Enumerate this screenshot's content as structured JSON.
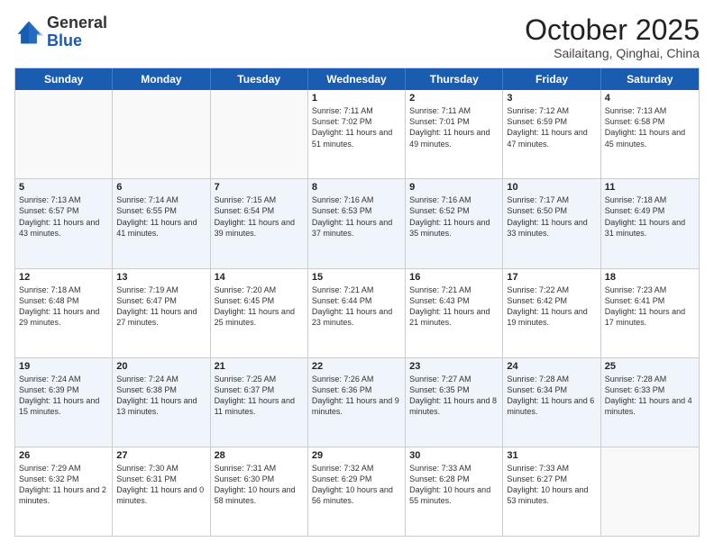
{
  "logo": {
    "general": "General",
    "blue": "Blue"
  },
  "header": {
    "month": "October 2025",
    "location": "Sailaitang, Qinghai, China"
  },
  "dayHeaders": [
    "Sunday",
    "Monday",
    "Tuesday",
    "Wednesday",
    "Thursday",
    "Friday",
    "Saturday"
  ],
  "weeks": [
    [
      {
        "day": "",
        "sunrise": "",
        "sunset": "",
        "daylight": "",
        "empty": true
      },
      {
        "day": "",
        "sunrise": "",
        "sunset": "",
        "daylight": "",
        "empty": true
      },
      {
        "day": "",
        "sunrise": "",
        "sunset": "",
        "daylight": "",
        "empty": true
      },
      {
        "day": "1",
        "sunrise": "Sunrise: 7:11 AM",
        "sunset": "Sunset: 7:02 PM",
        "daylight": "Daylight: 11 hours and 51 minutes.",
        "empty": false
      },
      {
        "day": "2",
        "sunrise": "Sunrise: 7:11 AM",
        "sunset": "Sunset: 7:01 PM",
        "daylight": "Daylight: 11 hours and 49 minutes.",
        "empty": false
      },
      {
        "day": "3",
        "sunrise": "Sunrise: 7:12 AM",
        "sunset": "Sunset: 6:59 PM",
        "daylight": "Daylight: 11 hours and 47 minutes.",
        "empty": false
      },
      {
        "day": "4",
        "sunrise": "Sunrise: 7:13 AM",
        "sunset": "Sunset: 6:58 PM",
        "daylight": "Daylight: 11 hours and 45 minutes.",
        "empty": false
      }
    ],
    [
      {
        "day": "5",
        "sunrise": "Sunrise: 7:13 AM",
        "sunset": "Sunset: 6:57 PM",
        "daylight": "Daylight: 11 hours and 43 minutes.",
        "empty": false
      },
      {
        "day": "6",
        "sunrise": "Sunrise: 7:14 AM",
        "sunset": "Sunset: 6:55 PM",
        "daylight": "Daylight: 11 hours and 41 minutes.",
        "empty": false
      },
      {
        "day": "7",
        "sunrise": "Sunrise: 7:15 AM",
        "sunset": "Sunset: 6:54 PM",
        "daylight": "Daylight: 11 hours and 39 minutes.",
        "empty": false
      },
      {
        "day": "8",
        "sunrise": "Sunrise: 7:16 AM",
        "sunset": "Sunset: 6:53 PM",
        "daylight": "Daylight: 11 hours and 37 minutes.",
        "empty": false
      },
      {
        "day": "9",
        "sunrise": "Sunrise: 7:16 AM",
        "sunset": "Sunset: 6:52 PM",
        "daylight": "Daylight: 11 hours and 35 minutes.",
        "empty": false
      },
      {
        "day": "10",
        "sunrise": "Sunrise: 7:17 AM",
        "sunset": "Sunset: 6:50 PM",
        "daylight": "Daylight: 11 hours and 33 minutes.",
        "empty": false
      },
      {
        "day": "11",
        "sunrise": "Sunrise: 7:18 AM",
        "sunset": "Sunset: 6:49 PM",
        "daylight": "Daylight: 11 hours and 31 minutes.",
        "empty": false
      }
    ],
    [
      {
        "day": "12",
        "sunrise": "Sunrise: 7:18 AM",
        "sunset": "Sunset: 6:48 PM",
        "daylight": "Daylight: 11 hours and 29 minutes.",
        "empty": false
      },
      {
        "day": "13",
        "sunrise": "Sunrise: 7:19 AM",
        "sunset": "Sunset: 6:47 PM",
        "daylight": "Daylight: 11 hours and 27 minutes.",
        "empty": false
      },
      {
        "day": "14",
        "sunrise": "Sunrise: 7:20 AM",
        "sunset": "Sunset: 6:45 PM",
        "daylight": "Daylight: 11 hours and 25 minutes.",
        "empty": false
      },
      {
        "day": "15",
        "sunrise": "Sunrise: 7:21 AM",
        "sunset": "Sunset: 6:44 PM",
        "daylight": "Daylight: 11 hours and 23 minutes.",
        "empty": false
      },
      {
        "day": "16",
        "sunrise": "Sunrise: 7:21 AM",
        "sunset": "Sunset: 6:43 PM",
        "daylight": "Daylight: 11 hours and 21 minutes.",
        "empty": false
      },
      {
        "day": "17",
        "sunrise": "Sunrise: 7:22 AM",
        "sunset": "Sunset: 6:42 PM",
        "daylight": "Daylight: 11 hours and 19 minutes.",
        "empty": false
      },
      {
        "day": "18",
        "sunrise": "Sunrise: 7:23 AM",
        "sunset": "Sunset: 6:41 PM",
        "daylight": "Daylight: 11 hours and 17 minutes.",
        "empty": false
      }
    ],
    [
      {
        "day": "19",
        "sunrise": "Sunrise: 7:24 AM",
        "sunset": "Sunset: 6:39 PM",
        "daylight": "Daylight: 11 hours and 15 minutes.",
        "empty": false
      },
      {
        "day": "20",
        "sunrise": "Sunrise: 7:24 AM",
        "sunset": "Sunset: 6:38 PM",
        "daylight": "Daylight: 11 hours and 13 minutes.",
        "empty": false
      },
      {
        "day": "21",
        "sunrise": "Sunrise: 7:25 AM",
        "sunset": "Sunset: 6:37 PM",
        "daylight": "Daylight: 11 hours and 11 minutes.",
        "empty": false
      },
      {
        "day": "22",
        "sunrise": "Sunrise: 7:26 AM",
        "sunset": "Sunset: 6:36 PM",
        "daylight": "Daylight: 11 hours and 9 minutes.",
        "empty": false
      },
      {
        "day": "23",
        "sunrise": "Sunrise: 7:27 AM",
        "sunset": "Sunset: 6:35 PM",
        "daylight": "Daylight: 11 hours and 8 minutes.",
        "empty": false
      },
      {
        "day": "24",
        "sunrise": "Sunrise: 7:28 AM",
        "sunset": "Sunset: 6:34 PM",
        "daylight": "Daylight: 11 hours and 6 minutes.",
        "empty": false
      },
      {
        "day": "25",
        "sunrise": "Sunrise: 7:28 AM",
        "sunset": "Sunset: 6:33 PM",
        "daylight": "Daylight: 11 hours and 4 minutes.",
        "empty": false
      }
    ],
    [
      {
        "day": "26",
        "sunrise": "Sunrise: 7:29 AM",
        "sunset": "Sunset: 6:32 PM",
        "daylight": "Daylight: 11 hours and 2 minutes.",
        "empty": false
      },
      {
        "day": "27",
        "sunrise": "Sunrise: 7:30 AM",
        "sunset": "Sunset: 6:31 PM",
        "daylight": "Daylight: 11 hours and 0 minutes.",
        "empty": false
      },
      {
        "day": "28",
        "sunrise": "Sunrise: 7:31 AM",
        "sunset": "Sunset: 6:30 PM",
        "daylight": "Daylight: 10 hours and 58 minutes.",
        "empty": false
      },
      {
        "day": "29",
        "sunrise": "Sunrise: 7:32 AM",
        "sunset": "Sunset: 6:29 PM",
        "daylight": "Daylight: 10 hours and 56 minutes.",
        "empty": false
      },
      {
        "day": "30",
        "sunrise": "Sunrise: 7:33 AM",
        "sunset": "Sunset: 6:28 PM",
        "daylight": "Daylight: 10 hours and 55 minutes.",
        "empty": false
      },
      {
        "day": "31",
        "sunrise": "Sunrise: 7:33 AM",
        "sunset": "Sunset: 6:27 PM",
        "daylight": "Daylight: 10 hours and 53 minutes.",
        "empty": false
      },
      {
        "day": "",
        "sunrise": "",
        "sunset": "",
        "daylight": "",
        "empty": true
      }
    ]
  ]
}
